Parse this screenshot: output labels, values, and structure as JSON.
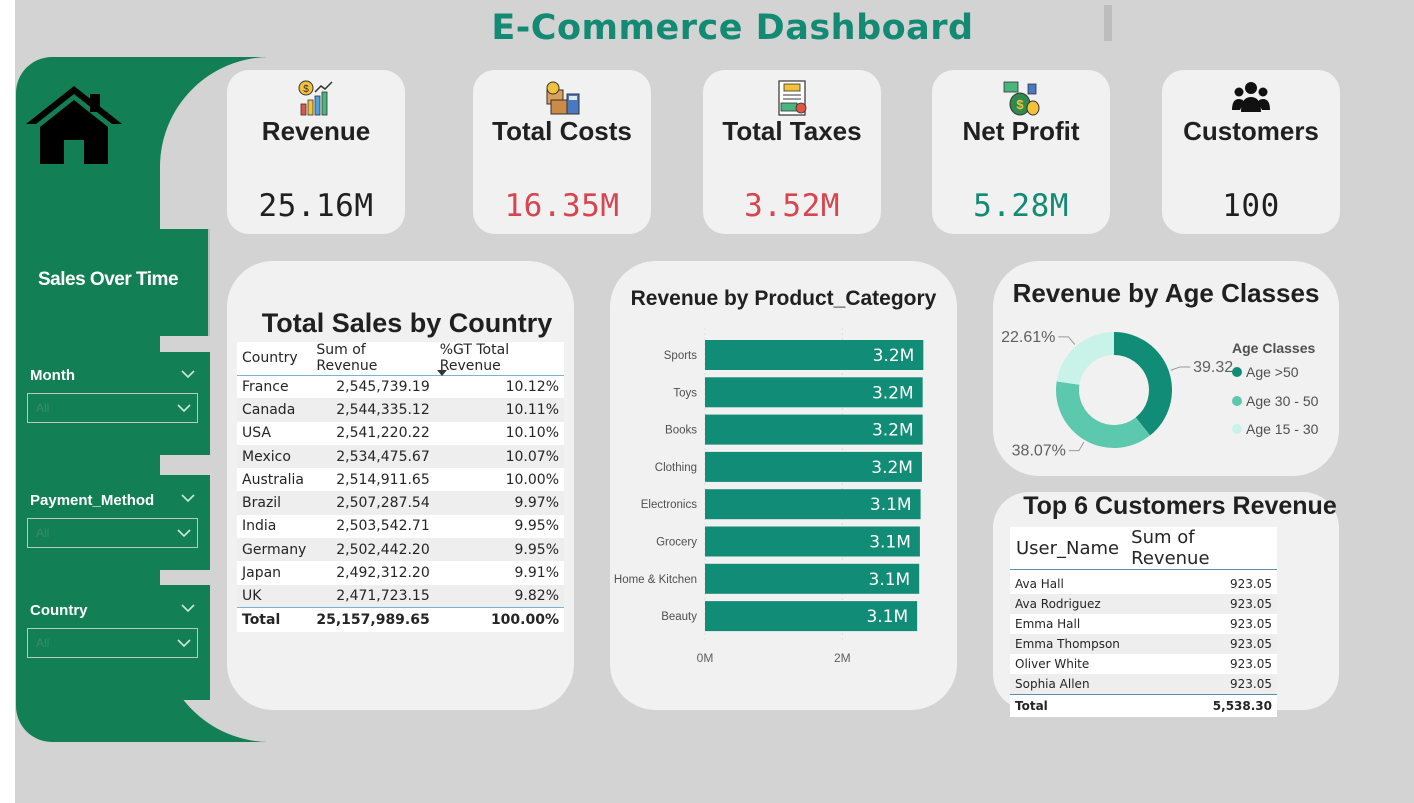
{
  "title": "E-Commerce Dashboard",
  "colors": {
    "accent": "#128054",
    "title": "#138a73",
    "bar": "#118c76",
    "negative": "#d64550",
    "positive": "#138a73",
    "age_gt50": "#118c76",
    "age_30_50": "#5cc8ad",
    "age_15_30": "#c9f3e8"
  },
  "sidebar": {
    "home_icon": "home-icon",
    "sales_over_time": "Sales Over Time",
    "filters": [
      {
        "label": "Month",
        "placeholder": "All"
      },
      {
        "label": "Payment_Method",
        "placeholder": "All"
      },
      {
        "label": "Country",
        "placeholder": "All"
      }
    ]
  },
  "kpis": [
    {
      "label": "Revenue",
      "value": "25.16M",
      "icon": "revenue-chart-icon"
    },
    {
      "label": "Total Costs",
      "value": "16.35M",
      "icon": "costs-boxes-icon"
    },
    {
      "label": "Total Taxes",
      "value": "3.52M",
      "icon": "tax-document-icon"
    },
    {
      "label": "Net Profit",
      "value": "5.28M",
      "icon": "money-bags-icon"
    },
    {
      "label": "Customers",
      "value": "100",
      "icon": "people-group-icon"
    }
  ],
  "country_table": {
    "title": "Total Sales by Country",
    "headers": [
      "Country",
      "Sum of Revenue",
      "%GT Total Revenue"
    ],
    "rows": [
      [
        "France",
        "2,545,739.19",
        "10.12%"
      ],
      [
        "Canada",
        "2,544,335.12",
        "10.11%"
      ],
      [
        "USA",
        "2,541,220.22",
        "10.10%"
      ],
      [
        "Mexico",
        "2,534,475.67",
        "10.07%"
      ],
      [
        "Australia",
        "2,514,911.65",
        "10.00%"
      ],
      [
        "Brazil",
        "2,507,287.54",
        "9.97%"
      ],
      [
        "India",
        "2,503,542.71",
        "9.95%"
      ],
      [
        "Germany",
        "2,502,442.20",
        "9.95%"
      ],
      [
        "Japan",
        "2,492,312.20",
        "9.91%"
      ],
      [
        "UK",
        "2,471,723.15",
        "9.82%"
      ]
    ],
    "total": [
      "Total",
      "25,157,989.65",
      "100.00%"
    ]
  },
  "chart_data": [
    {
      "type": "bar",
      "orientation": "horizontal",
      "title": "Revenue by Product_Category",
      "categories": [
        "Sports",
        "Toys",
        "Books",
        "Clothing",
        "Electronics",
        "Grocery",
        "Home & Kitchen",
        "Beauty"
      ],
      "values": [
        3.18,
        3.17,
        3.17,
        3.16,
        3.14,
        3.13,
        3.12,
        3.09
      ],
      "data_labels": [
        "3.2M",
        "3.2M",
        "3.2M",
        "3.2M",
        "3.1M",
        "3.1M",
        "3.1M",
        "3.1M"
      ],
      "x_ticks": [
        "0M",
        "2M"
      ],
      "xlim": [
        0,
        3.35
      ],
      "unit": "M",
      "grid": false
    },
    {
      "type": "pie",
      "variant": "donut",
      "title": "Revenue by Age Classes",
      "legend_title": "Age Classes",
      "legend_position": "right",
      "slices": [
        {
          "name": "Age >50",
          "value": 39.32,
          "label": "39.32%"
        },
        {
          "name": "Age 30 - 50",
          "value": 38.07,
          "label": "38.07%"
        },
        {
          "name": "Age 15 - 30",
          "value": 22.61,
          "label": "22.61%"
        }
      ]
    }
  ],
  "customers_table": {
    "title": "Top 6 Customers Revenue",
    "headers": [
      "User_Name",
      "Sum of Revenue"
    ],
    "rows": [
      [
        "Ava Hall",
        "923.05"
      ],
      [
        "Ava Rodriguez",
        "923.05"
      ],
      [
        "Emma Hall",
        "923.05"
      ],
      [
        "Emma Thompson",
        "923.05"
      ],
      [
        "Oliver White",
        "923.05"
      ],
      [
        "Sophia Allen",
        "923.05"
      ]
    ],
    "total": [
      "Total",
      "5,538.30"
    ]
  }
}
